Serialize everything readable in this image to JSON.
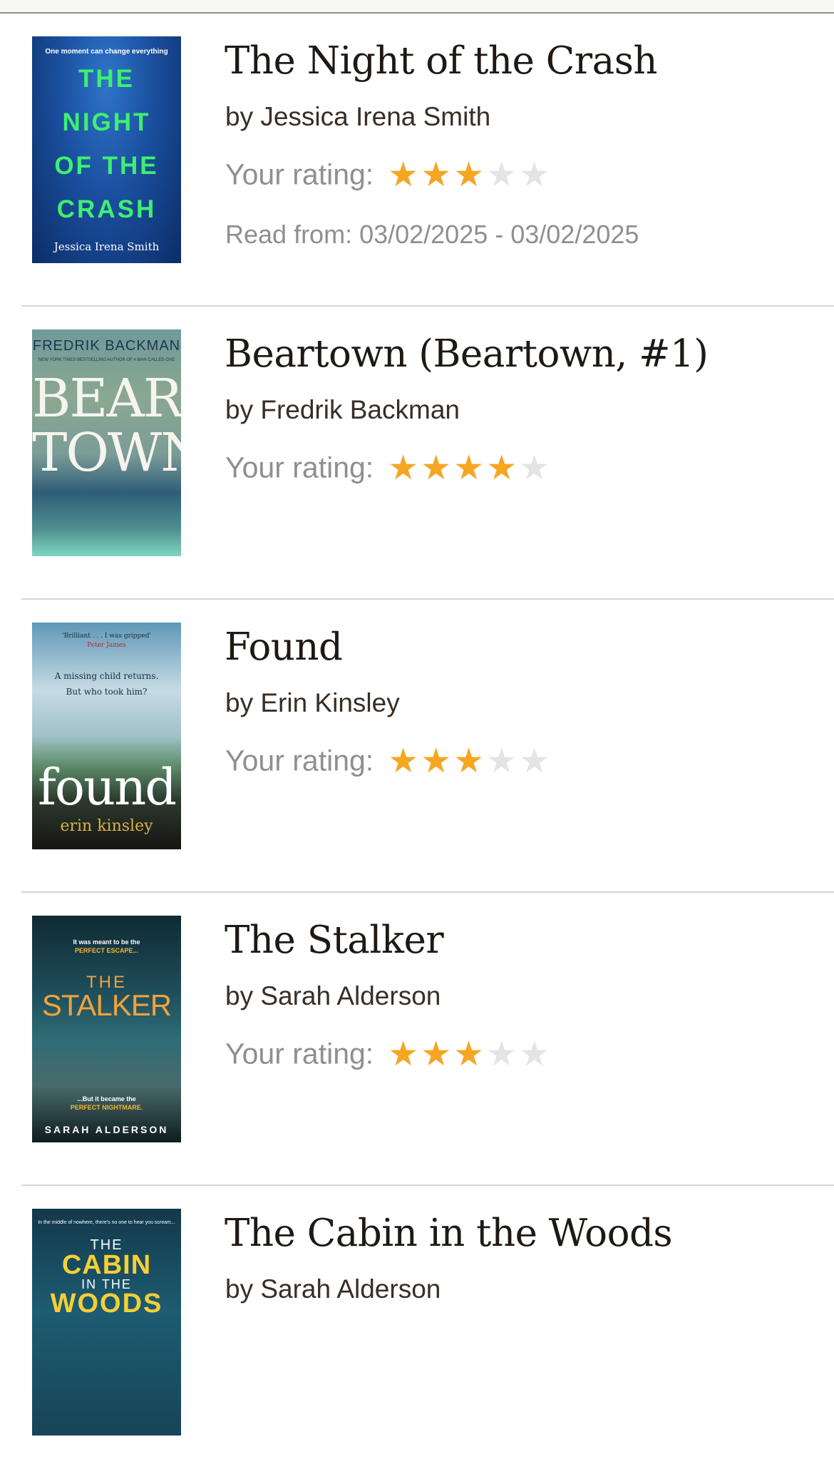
{
  "colors": {
    "star_filled": "#f5a623",
    "star_empty": "#e4e4e4"
  },
  "labels": {
    "rating": "Your rating:",
    "read_from": "Read from:"
  },
  "books": [
    {
      "title": "The Night of the Crash",
      "author": "by Jessica Irena Smith",
      "rating": 3,
      "read_from": "Read from: 03/02/2025 - 03/02/2025",
      "cover": {
        "tagline": "One moment can change everything",
        "lines": [
          "THE",
          "NIGHT",
          "OF THE",
          "CRASH"
        ],
        "author": "Jessica Irena Smith"
      }
    },
    {
      "title": "Beartown (Beartown, #1)",
      "author": "by Fredrik Backman",
      "rating": 4,
      "cover": {
        "author": "FREDRIK BACKMAN",
        "small": "NEW YORK TIMES BESTSELLING AUTHOR OF A MAN CALLED OVE",
        "lines": [
          "BEAR",
          "TOWN"
        ]
      }
    },
    {
      "title": "Found",
      "author": "by Erin Kinsley",
      "rating": 3,
      "cover": {
        "quote": "'Brilliant . . . I was gripped'",
        "quote_by": "Peter James",
        "taglines": [
          "A missing child returns.",
          "But who took him?"
        ],
        "title": "found",
        "author": "erin kinsley"
      }
    },
    {
      "title": "The Stalker",
      "author": "by Sarah Alderson",
      "rating": 3,
      "cover": {
        "tag1": "It was meant to be the",
        "tag2": "PERFECT ESCAPE...",
        "the": "THE",
        "title": "STALKER",
        "tag3": "...But it became the",
        "tag4": "PERFECT NIGHTMARE.",
        "author": "SARAH ALDERSON"
      }
    },
    {
      "title": "The Cabin in the Woods",
      "author": "by Sarah Alderson",
      "cover": {
        "tag": "In the middle of nowhere, there's no one to hear you scream...",
        "the": "THE",
        "title": "CABIN",
        "in_the": "IN THE",
        "woods": "WOODS"
      }
    }
  ]
}
